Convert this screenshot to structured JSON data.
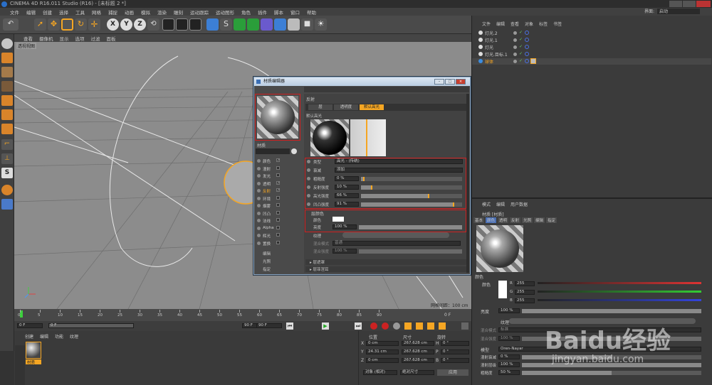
{
  "window": {
    "title": "CINEMA 4D R16.011 Studio (R16) - [未标题 2 *]"
  },
  "menubar": {
    "items": [
      "文件",
      "编辑",
      "创建",
      "选择",
      "工具",
      "网格",
      "捕捉",
      "动画",
      "模拟",
      "渲染",
      "雕刻",
      "运动跟踪",
      "运动图形",
      "角色",
      "插件",
      "脚本",
      "窗口",
      "帮助"
    ]
  },
  "layout": {
    "label": "界面:",
    "value": "启动"
  },
  "viewport": {
    "menu": [
      "查看",
      "摄像机",
      "显示",
      "选项",
      "过滤",
      "面板"
    ],
    "label": "透视视图",
    "grid_info": "网格间距：100 cm"
  },
  "timeline": {
    "ticks": [
      "0",
      "5",
      "10",
      "15",
      "20",
      "25",
      "30",
      "35",
      "40",
      "45",
      "50",
      "55",
      "60",
      "65",
      "70",
      "75",
      "80",
      "85",
      "90"
    ],
    "end_label": "0 F"
  },
  "transport": {
    "current_frame": "0 F",
    "start": "0 F",
    "preview_end": "90 F",
    "end": "90 F"
  },
  "material_manager": {
    "menu": [
      "创建",
      "编辑",
      "功能",
      "纹理"
    ],
    "material_name": "材质"
  },
  "coords": {
    "headers": [
      "位置",
      "尺寸",
      "旋转"
    ],
    "rows": [
      {
        "axis": "X",
        "pos": "0 cm",
        "size": "267.628 cm",
        "rot_axis": "H",
        "rot": "0 °"
      },
      {
        "axis": "Y",
        "pos": "24.31 cm",
        "size": "267.628 cm",
        "rot_axis": "P",
        "rot": "0 °"
      },
      {
        "axis": "Z",
        "pos": "0 cm",
        "size": "267.628 cm",
        "rot_axis": "B",
        "rot": "0 °"
      }
    ],
    "mode": "对象 (相对)",
    "size_mode": "绝对尺寸",
    "apply": "应用"
  },
  "object_manager": {
    "menu": [
      "文件",
      "编辑",
      "查看",
      "对象",
      "标签",
      "书签"
    ],
    "objects": [
      "灯光.2",
      "灯光.1",
      "灯光",
      "灯光.目标.1",
      "球体"
    ]
  },
  "attribute_manager": {
    "menu": [
      "模式",
      "编辑",
      "用户数据"
    ],
    "header": "材质 [材质]",
    "tabs": [
      "基本",
      "颜色",
      "透明",
      "反射",
      "光照",
      "编辑",
      "指定"
    ],
    "section": "颜色",
    "color_label": "颜色",
    "rgb": [
      {
        "ch": "R",
        "val": "255"
      },
      {
        "ch": "G",
        "val": "255"
      },
      {
        "ch": "B",
        "val": "255"
      }
    ],
    "brightness_label": "亮度",
    "brightness": "100 %",
    "texture_label": "纹理",
    "mix_mode_label": "混合模式",
    "mix_mode": "标准",
    "mix_strength_label": "混合强度",
    "mix_strength": "100 %",
    "model_label": "模型",
    "model": "Oren-Nayar",
    "diffuse_falloff_label": "漫射衰减",
    "diffuse_falloff": "0 %",
    "diffuse_level_label": "漫射层级",
    "diffuse_level": "100 %",
    "roughness_label": "粗糙度",
    "roughness": "50 %"
  },
  "dialog": {
    "title": "材质编辑器",
    "section": "反射",
    "layer_tabs": [
      "层",
      "透明度",
      "默认高光"
    ],
    "layer_name": "默认高光",
    "material_name": "材质",
    "channels": [
      {
        "name": "颜色",
        "checked": true
      },
      {
        "name": "漫射",
        "checked": false
      },
      {
        "name": "发光",
        "checked": false
      },
      {
        "name": "透明",
        "checked": true
      },
      {
        "name": "反射",
        "checked": true,
        "active": true
      },
      {
        "name": "环境",
        "checked": false
      },
      {
        "name": "烟雾",
        "checked": false
      },
      {
        "name": "凹凸",
        "checked": false
      },
      {
        "name": "法线",
        "checked": false
      },
      {
        "name": "Alpha",
        "checked": false
      },
      {
        "name": "辉光",
        "checked": false
      },
      {
        "name": "置换",
        "checked": false
      }
    ],
    "extras": [
      "编辑",
      "光照",
      "指定"
    ],
    "type_label": "类型",
    "type_value": "高光 - (传统)",
    "decay_label": "衰减",
    "decay_value": "添加",
    "roughness_label": "粗糙度",
    "roughness": "0 %",
    "reflect_label": "反射强度",
    "reflect": "10 %",
    "spec_label": "高光强度",
    "spec": "66 %",
    "bump_label": "凹凸强度",
    "bump": "91 %",
    "layer_color_label": "层颜色",
    "color_label": "颜色",
    "brightness_label": "亮度",
    "brightness": "100 %",
    "texture_label": "纹理",
    "mix_mode_label": "混合模式",
    "mix_mode": "普通",
    "mix_strength_label": "混合强度",
    "mix_strength": "100 %",
    "collapsed": [
      "层遮罩",
      "层菲涅耳"
    ]
  },
  "colors": {
    "accent": "#f5a623",
    "red_outline": "#d02020",
    "viewport": "#8c8c8c"
  },
  "watermark": {
    "text": "Baidu经验",
    "url": "jingyan.baidu.com"
  }
}
